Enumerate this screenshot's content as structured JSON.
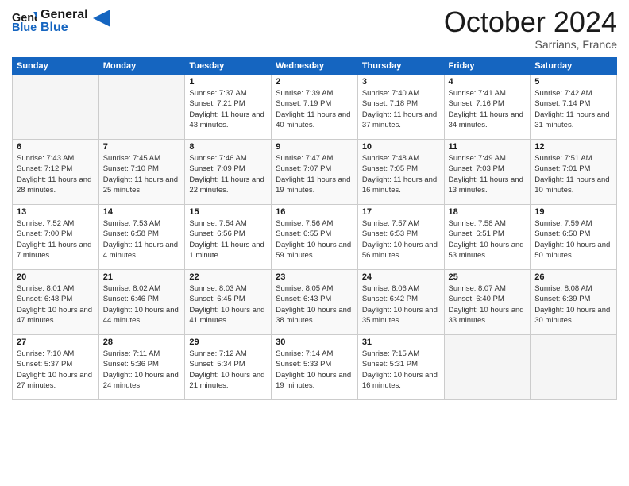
{
  "header": {
    "logo_general": "General",
    "logo_blue": "Blue",
    "month_title": "October 2024",
    "location": "Sarrians, France"
  },
  "days_of_week": [
    "Sunday",
    "Monday",
    "Tuesday",
    "Wednesday",
    "Thursday",
    "Friday",
    "Saturday"
  ],
  "weeks": [
    [
      {
        "day": "",
        "sunrise": "",
        "sunset": "",
        "daylight": "",
        "empty": true
      },
      {
        "day": "",
        "sunrise": "",
        "sunset": "",
        "daylight": "",
        "empty": true
      },
      {
        "day": "1",
        "sunrise": "Sunrise: 7:37 AM",
        "sunset": "Sunset: 7:21 PM",
        "daylight": "Daylight: 11 hours and 43 minutes."
      },
      {
        "day": "2",
        "sunrise": "Sunrise: 7:39 AM",
        "sunset": "Sunset: 7:19 PM",
        "daylight": "Daylight: 11 hours and 40 minutes."
      },
      {
        "day": "3",
        "sunrise": "Sunrise: 7:40 AM",
        "sunset": "Sunset: 7:18 PM",
        "daylight": "Daylight: 11 hours and 37 minutes."
      },
      {
        "day": "4",
        "sunrise": "Sunrise: 7:41 AM",
        "sunset": "Sunset: 7:16 PM",
        "daylight": "Daylight: 11 hours and 34 minutes."
      },
      {
        "day": "5",
        "sunrise": "Sunrise: 7:42 AM",
        "sunset": "Sunset: 7:14 PM",
        "daylight": "Daylight: 11 hours and 31 minutes."
      }
    ],
    [
      {
        "day": "6",
        "sunrise": "Sunrise: 7:43 AM",
        "sunset": "Sunset: 7:12 PM",
        "daylight": "Daylight: 11 hours and 28 minutes."
      },
      {
        "day": "7",
        "sunrise": "Sunrise: 7:45 AM",
        "sunset": "Sunset: 7:10 PM",
        "daylight": "Daylight: 11 hours and 25 minutes."
      },
      {
        "day": "8",
        "sunrise": "Sunrise: 7:46 AM",
        "sunset": "Sunset: 7:09 PM",
        "daylight": "Daylight: 11 hours and 22 minutes."
      },
      {
        "day": "9",
        "sunrise": "Sunrise: 7:47 AM",
        "sunset": "Sunset: 7:07 PM",
        "daylight": "Daylight: 11 hours and 19 minutes."
      },
      {
        "day": "10",
        "sunrise": "Sunrise: 7:48 AM",
        "sunset": "Sunset: 7:05 PM",
        "daylight": "Daylight: 11 hours and 16 minutes."
      },
      {
        "day": "11",
        "sunrise": "Sunrise: 7:49 AM",
        "sunset": "Sunset: 7:03 PM",
        "daylight": "Daylight: 11 hours and 13 minutes."
      },
      {
        "day": "12",
        "sunrise": "Sunrise: 7:51 AM",
        "sunset": "Sunset: 7:01 PM",
        "daylight": "Daylight: 11 hours and 10 minutes."
      }
    ],
    [
      {
        "day": "13",
        "sunrise": "Sunrise: 7:52 AM",
        "sunset": "Sunset: 7:00 PM",
        "daylight": "Daylight: 11 hours and 7 minutes."
      },
      {
        "day": "14",
        "sunrise": "Sunrise: 7:53 AM",
        "sunset": "Sunset: 6:58 PM",
        "daylight": "Daylight: 11 hours and 4 minutes."
      },
      {
        "day": "15",
        "sunrise": "Sunrise: 7:54 AM",
        "sunset": "Sunset: 6:56 PM",
        "daylight": "Daylight: 11 hours and 1 minute."
      },
      {
        "day": "16",
        "sunrise": "Sunrise: 7:56 AM",
        "sunset": "Sunset: 6:55 PM",
        "daylight": "Daylight: 10 hours and 59 minutes."
      },
      {
        "day": "17",
        "sunrise": "Sunrise: 7:57 AM",
        "sunset": "Sunset: 6:53 PM",
        "daylight": "Daylight: 10 hours and 56 minutes."
      },
      {
        "day": "18",
        "sunrise": "Sunrise: 7:58 AM",
        "sunset": "Sunset: 6:51 PM",
        "daylight": "Daylight: 10 hours and 53 minutes."
      },
      {
        "day": "19",
        "sunrise": "Sunrise: 7:59 AM",
        "sunset": "Sunset: 6:50 PM",
        "daylight": "Daylight: 10 hours and 50 minutes."
      }
    ],
    [
      {
        "day": "20",
        "sunrise": "Sunrise: 8:01 AM",
        "sunset": "Sunset: 6:48 PM",
        "daylight": "Daylight: 10 hours and 47 minutes."
      },
      {
        "day": "21",
        "sunrise": "Sunrise: 8:02 AM",
        "sunset": "Sunset: 6:46 PM",
        "daylight": "Daylight: 10 hours and 44 minutes."
      },
      {
        "day": "22",
        "sunrise": "Sunrise: 8:03 AM",
        "sunset": "Sunset: 6:45 PM",
        "daylight": "Daylight: 10 hours and 41 minutes."
      },
      {
        "day": "23",
        "sunrise": "Sunrise: 8:05 AM",
        "sunset": "Sunset: 6:43 PM",
        "daylight": "Daylight: 10 hours and 38 minutes."
      },
      {
        "day": "24",
        "sunrise": "Sunrise: 8:06 AM",
        "sunset": "Sunset: 6:42 PM",
        "daylight": "Daylight: 10 hours and 35 minutes."
      },
      {
        "day": "25",
        "sunrise": "Sunrise: 8:07 AM",
        "sunset": "Sunset: 6:40 PM",
        "daylight": "Daylight: 10 hours and 33 minutes."
      },
      {
        "day": "26",
        "sunrise": "Sunrise: 8:08 AM",
        "sunset": "Sunset: 6:39 PM",
        "daylight": "Daylight: 10 hours and 30 minutes."
      }
    ],
    [
      {
        "day": "27",
        "sunrise": "Sunrise: 7:10 AM",
        "sunset": "Sunset: 5:37 PM",
        "daylight": "Daylight: 10 hours and 27 minutes."
      },
      {
        "day": "28",
        "sunrise": "Sunrise: 7:11 AM",
        "sunset": "Sunset: 5:36 PM",
        "daylight": "Daylight: 10 hours and 24 minutes."
      },
      {
        "day": "29",
        "sunrise": "Sunrise: 7:12 AM",
        "sunset": "Sunset: 5:34 PM",
        "daylight": "Daylight: 10 hours and 21 minutes."
      },
      {
        "day": "30",
        "sunrise": "Sunrise: 7:14 AM",
        "sunset": "Sunset: 5:33 PM",
        "daylight": "Daylight: 10 hours and 19 minutes."
      },
      {
        "day": "31",
        "sunrise": "Sunrise: 7:15 AM",
        "sunset": "Sunset: 5:31 PM",
        "daylight": "Daylight: 10 hours and 16 minutes."
      },
      {
        "day": "",
        "sunrise": "",
        "sunset": "",
        "daylight": "",
        "empty": true
      },
      {
        "day": "",
        "sunrise": "",
        "sunset": "",
        "daylight": "",
        "empty": true
      }
    ]
  ]
}
